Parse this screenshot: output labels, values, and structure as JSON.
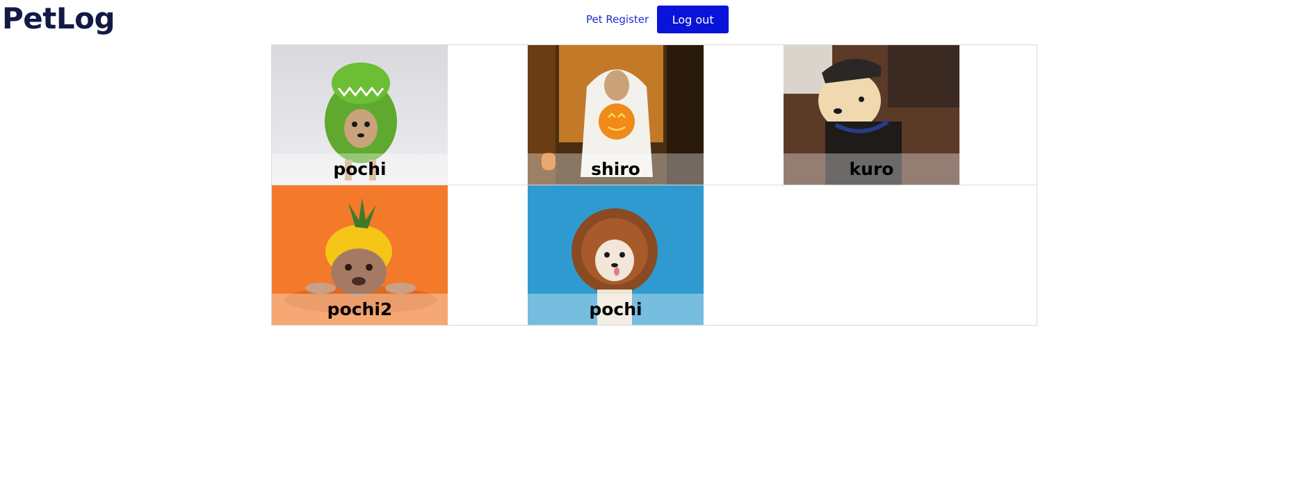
{
  "app": {
    "title": "PetLog"
  },
  "nav": {
    "register_label": "Pet Register",
    "logout_label": "Log out"
  },
  "pets": [
    {
      "name": "pochi",
      "costume": "green dinosaur costume",
      "bg_color": "#e6e6ea"
    },
    {
      "name": "shiro",
      "costume": "ghost with pumpkin",
      "bg_color": "#5a3a1a"
    },
    {
      "name": "kuro",
      "costume": "dog with cap",
      "bg_color": "#4a2f22"
    },
    {
      "name": "pochi2",
      "costume": "pineapple hat",
      "bg_color": "#f27a2a"
    },
    {
      "name": "pochi",
      "costume": "lion mane",
      "bg_color": "#2f9ad0"
    }
  ],
  "colors": {
    "accent": "#0a14d8",
    "logo": "#121a45",
    "link": "#1f2bd0"
  }
}
